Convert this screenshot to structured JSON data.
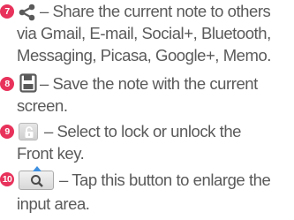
{
  "items": [
    {
      "number": "7",
      "icon": "share-icon",
      "lines": [
        "– Share the current note to others",
        "via Gmail, E-mail, Social+, Bluetooth,",
        "Messaging, Picasa, Google+, Memo."
      ]
    },
    {
      "number": "8",
      "icon": "save-icon",
      "lines": [
        "– Save the note with the current",
        "screen."
      ]
    },
    {
      "number": "9",
      "icon": "lock-icon",
      "lines": [
        "– Select to lock or unlock the",
        "Front key."
      ]
    },
    {
      "number": "10",
      "icon": "enlarge-icon",
      "lines": [
        "– Tap this button to enlarge the",
        "input area."
      ]
    }
  ],
  "colors": {
    "number_badge": "#e8325b",
    "text": "#5a5a5a",
    "enlarge_arrow": "#3d8fe0"
  }
}
